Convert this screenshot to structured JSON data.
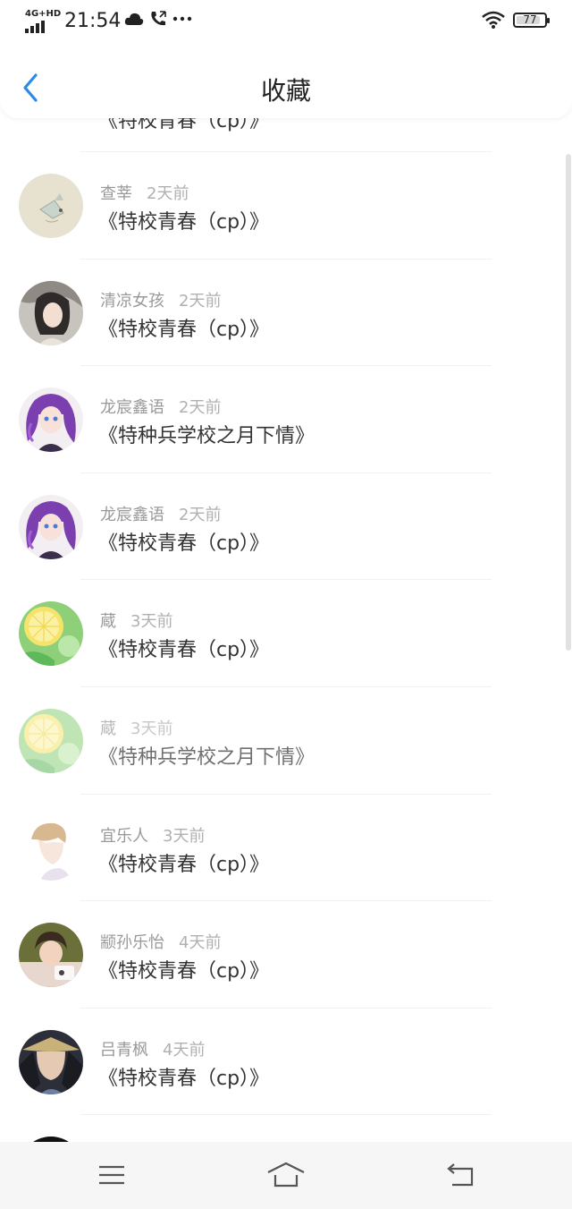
{
  "status_bar": {
    "network": "4G+HD",
    "time": "21:54",
    "battery_level": "77",
    "icons": [
      "cloud-icon",
      "phone-icon",
      "more-dots-icon",
      "wifi-icon",
      "battery-icon"
    ]
  },
  "nav": {
    "title": "收藏",
    "back_icon": "chevron-left-icon",
    "accent_color": "#2b8ce8"
  },
  "partial_top_row": {
    "title": "《特校青春（cp）》"
  },
  "items": [
    {
      "name": "查莘",
      "time": "2天前",
      "title": "《特校青春（cp）》",
      "avatar": "paper-bird"
    },
    {
      "name": "清凉女孩",
      "time": "2天前",
      "title": "《特校青春（cp）》",
      "avatar": "girl-portrait"
    },
    {
      "name": "龙宸鑫语",
      "time": "2天前",
      "title": "《特种兵学校之月下情》",
      "avatar": "anime-purple-hair"
    },
    {
      "name": "龙宸鑫语",
      "time": "2天前",
      "title": "《特校青春（cp）》",
      "avatar": "anime-purple-hair"
    },
    {
      "name": "蔵",
      "time": "3天前",
      "title": "《特校青春（cp）》",
      "avatar": "lemon-drink"
    },
    {
      "name": "蔵",
      "time": "3天前",
      "title": "《特种兵学校之月下情》",
      "avatar": "lemon-drink"
    },
    {
      "name": "宜乐人",
      "time": "3天前",
      "title": "《特校青春（cp）》",
      "avatar": "boy-sketch"
    },
    {
      "name": "颛孙乐怡",
      "time": "4天前",
      "title": "《特校青春（cp）》",
      "avatar": "child-photo"
    },
    {
      "name": "吕青枫",
      "time": "4天前",
      "title": "《特校青春（cp）》",
      "avatar": "warrior-portrait"
    }
  ],
  "bottom_nav": [
    "menu-icon",
    "home-icon",
    "back-icon"
  ]
}
